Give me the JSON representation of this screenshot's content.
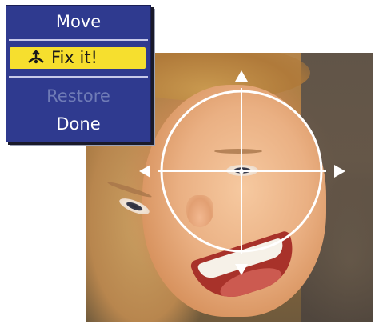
{
  "menu": {
    "items": [
      {
        "label": "Move",
        "state": "normal"
      },
      {
        "label": "Fix it!",
        "state": "selected",
        "icon": "retouch-wand-icon"
      },
      {
        "label": "Restore",
        "state": "disabled"
      },
      {
        "label": "Done",
        "state": "normal"
      }
    ]
  },
  "colors": {
    "menu_background": "#2f3a8f",
    "selected_highlight": "#f6df2e",
    "disabled_text": "#6f7bb6",
    "crosshair": "#ffffff"
  },
  "photo": {
    "subject": "smiling child"
  },
  "tool": {
    "name": "red-eye crosshair",
    "arrows": [
      "up",
      "down",
      "left",
      "right"
    ]
  }
}
